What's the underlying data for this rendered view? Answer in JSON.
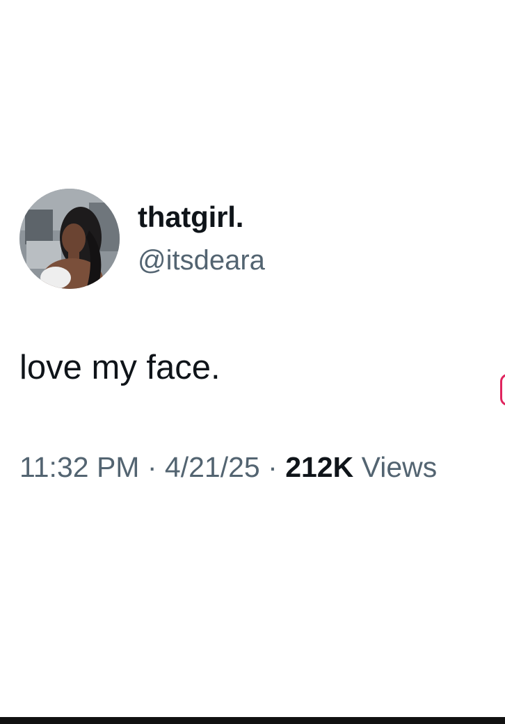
{
  "tweet": {
    "display_name": "thatgirl.",
    "handle": "@itsdeara",
    "text": "love my face.",
    "time": "11:32 PM",
    "separator": "·",
    "date": "4/21/25",
    "view_count": "212K",
    "views_label": "Views"
  },
  "icons": {
    "avatar": "profile-photo"
  },
  "colors": {
    "primary_text": "#0f1419",
    "secondary_text": "#536471",
    "background": "#ffffff"
  }
}
